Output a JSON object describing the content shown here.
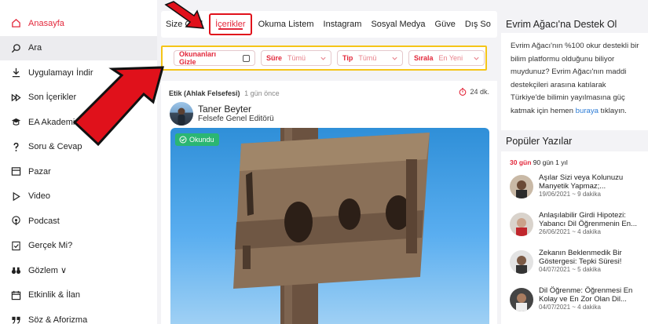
{
  "sidebar": {
    "items": [
      {
        "label": "Anasayfa",
        "icon": "home-icon",
        "active": true
      },
      {
        "label": "Ara",
        "icon": "search-icon",
        "hover": true
      },
      {
        "label": "Uygulamayı İndir",
        "icon": "download-icon"
      },
      {
        "label": "Son İçerikler",
        "icon": "fast-forward-icon"
      },
      {
        "label": "EA Akademi",
        "icon": "graduation-cap-icon"
      },
      {
        "label": "Soru & Cevap",
        "icon": "question-icon"
      },
      {
        "label": "Pazar",
        "icon": "store-icon"
      },
      {
        "label": "Video",
        "icon": "play-icon"
      },
      {
        "label": "Podcast",
        "icon": "podcast-icon"
      },
      {
        "label": "Gerçek Mi?",
        "icon": "check-document-icon"
      },
      {
        "label": "Gözlem ∨",
        "icon": "binoculars-icon"
      },
      {
        "label": "Etkinlik & İlan",
        "icon": "calendar-icon"
      },
      {
        "label": "Söz & Aforizma",
        "icon": "quote-icon"
      }
    ]
  },
  "tabs": [
    {
      "label": "Size Özel"
    },
    {
      "label": "İçerikler",
      "active": true
    },
    {
      "label": "Okuma Listem"
    },
    {
      "label": "Instagram"
    },
    {
      "label": "Sosyal Medya"
    },
    {
      "label": "Güve"
    },
    {
      "label": "Dış So"
    }
  ],
  "filters": {
    "hide_read": "Okunanları Gizle",
    "duration_label": "Süre",
    "duration_value": "Tümü",
    "type_label": "Tip",
    "type_value": "Tümü",
    "sort_label": "Sırala",
    "sort_value": "En Yeni"
  },
  "post": {
    "category": "Etik (Ahlak Felsefesi)",
    "time_ago": "1 gün önce",
    "read_time": "24 dk.",
    "author_name": "Taner Beyter",
    "author_role": "Felsefe Genel Editörü",
    "badge": "Okundu"
  },
  "support": {
    "title": "Evrim Ağacı'na Destek Ol",
    "text_before": "Evrim Ağacı'nın %100 okur destekli bir bilim platformu olduğunu biliyor muydunuz? Evrim Ağacı'nın maddi destekçileri arasına katılarak Türkiye'de bilimin yayılmasına güç katmak için hemen",
    "link": "buraya",
    "text_after": "tıklayın."
  },
  "popular": {
    "title": "Popüler Yazılar",
    "range_tabs": [
      "30 gün",
      "90 gün",
      "1 yıl"
    ],
    "items": [
      {
        "title": "Aşılar Sizi veya Kolunuzu Manyetik Yapmaz;...",
        "date": "19/06/2021 ~ 9 dakika"
      },
      {
        "title": "Anlaşılabilir Girdi Hipotezi: Yabancı Dil Öğrenmenin En...",
        "date": "26/06/2021 ~ 4 dakika"
      },
      {
        "title": "Zekanın Beklenmedik Bir Göstergesi: Tepki Süresi!",
        "date": "04/07/2021 ~ 5 dakika"
      },
      {
        "title": "Dil Öğrenme: Öğrenmesi En Kolay ve En Zor Olan Dil...",
        "date": "04/07/2021 ~ 4 dakika"
      }
    ]
  },
  "colors": {
    "accent": "#e3283b",
    "filter_border": "#f5c518",
    "badge": "#2bb673",
    "annotation": "#e0111b"
  }
}
